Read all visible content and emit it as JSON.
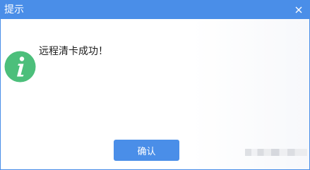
{
  "dialog": {
    "title": "提示",
    "message": "远程清卡成功！",
    "ok_label": "确认",
    "icon": "info-icon"
  },
  "colors": {
    "accent": "#4a8ee8",
    "info_icon": "#4cbf7b"
  }
}
